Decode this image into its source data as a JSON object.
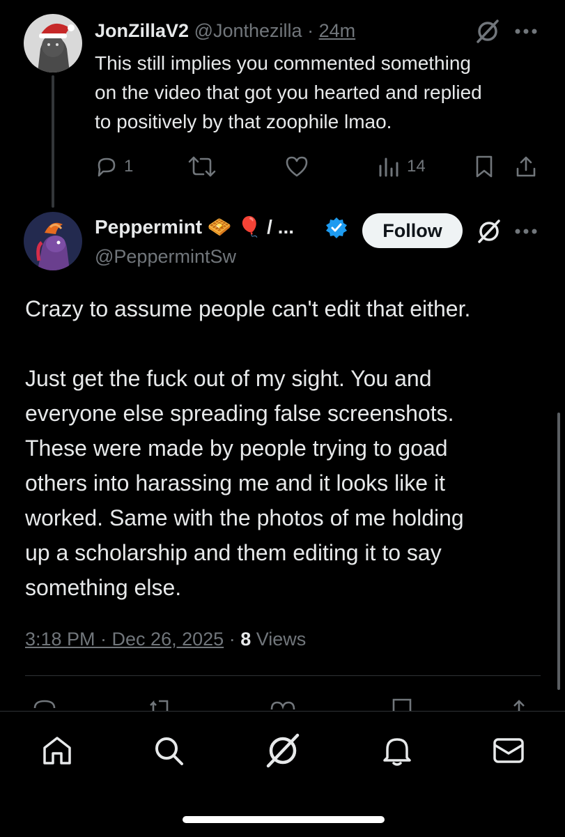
{
  "reply": {
    "display_name": "JonZillaV2",
    "handle": "@Jonthezilla",
    "separator": "·",
    "time": "24m",
    "text_lines": [
      "This still implies you commented something",
      "on the video that got you hearted and replied",
      "to positively by that zoophile lmao."
    ],
    "reply_count": "1",
    "view_count": "14"
  },
  "main": {
    "display_name": "Peppermint",
    "name_suffix": "/ ...",
    "emoji_1": "🧇",
    "emoji_2": "🎈",
    "handle": "@PeppermintSw",
    "follow_label": "Follow",
    "paragraph_1": "Crazy to assume people can't edit that either.",
    "paragraph_2_lines": [
      "Just get the fuck out of my sight. You and",
      "everyone else spreading false screenshots.",
      "These were made by people trying to goad",
      "others into harassing me and it looks like it",
      "worked. Same with the photos of me holding",
      "up a scholarship and them editing it to say",
      "something else."
    ],
    "timestamp": "3:18 PM · Dec 26, 2025",
    "meta_separator": "·",
    "views_count": "8",
    "views_label": "Views"
  },
  "icons": {
    "grok": "grok-icon",
    "more": "more-icon",
    "reply": "reply-icon",
    "retweet": "retweet-icon",
    "like": "heart-icon",
    "views": "views-icon",
    "bookmark": "bookmark-icon",
    "share": "share-icon",
    "verified": "verified-badge-icon"
  },
  "nav": [
    "home-icon",
    "search-icon",
    "grok-icon",
    "notifications-icon",
    "messages-icon"
  ],
  "colors": {
    "background": "#000000",
    "text": "#e7e9ea",
    "muted": "#71767b",
    "verified": "#1d9bf0",
    "follow_bg": "#eff3f4"
  }
}
